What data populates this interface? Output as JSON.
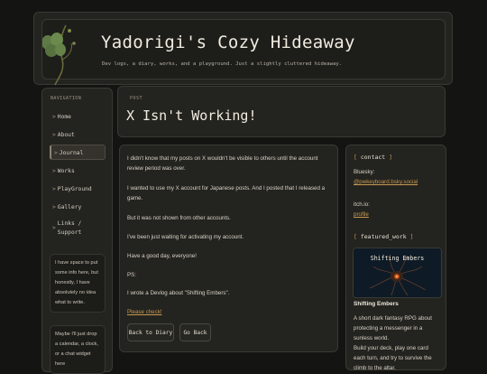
{
  "header": {
    "title": "Yadorigi's Cozy Hideaway",
    "subtitle": "Dev logs, a diary, works, and a playground. Just a slightly cluttered hideaway."
  },
  "nav": {
    "heading": "NAVIGATION",
    "items": [
      {
        "label": "Home"
      },
      {
        "label": "About"
      },
      {
        "label": "Journal",
        "active": true
      },
      {
        "label": "Works"
      },
      {
        "label": "PlayGround"
      },
      {
        "label": "Gallery"
      },
      {
        "label": "Links /"
      },
      {
        "label": "Support"
      }
    ],
    "notes": [
      "I have space to put some info here, but honestly, I have absolutely no idea what to write.",
      "Maybe I'll just drop a calendar, a clock, or a chat widget here"
    ]
  },
  "post": {
    "label": "POST",
    "title": "X Isn't Working!",
    "paragraphs": [
      "I didn't know that my posts on X wouldn't be visible to others until the account review period was over.",
      "I wanted to use my X account for Japanese posts. And I posted that I released a game.",
      "But it was not shown from other accounts.",
      "I've been just waiting for activating my account.",
      "Have a good day, everyone!",
      "PS:",
      "I wrote a Devlog about \"Shifting Embers\".",
      "Please check!"
    ],
    "buttons": {
      "back": "Back to Diary",
      "go_back": "Go Back"
    }
  },
  "sidebar": {
    "contact_tag": "contact",
    "bluesky_label": "Bluesky:",
    "bluesky_handle": "@pwkeyboard.bsky.social",
    "itchio_label": "itch.io:",
    "itchio_link": "profile",
    "featured_tag": "featured_work",
    "featured_thumb_title": "Shifting Embers",
    "featured_name": "Shifting Embers",
    "featured_desc": "A short dark fantasy RPG about protecting a messenger in a sunless world.",
    "featured_desc2": "Build your deck, play one card each turn, and try to survive the climb to the altar."
  },
  "colors": {
    "background": "#141412",
    "panel": "#232320",
    "accent": "#c79a4f",
    "text": "#d8d2c4"
  }
}
